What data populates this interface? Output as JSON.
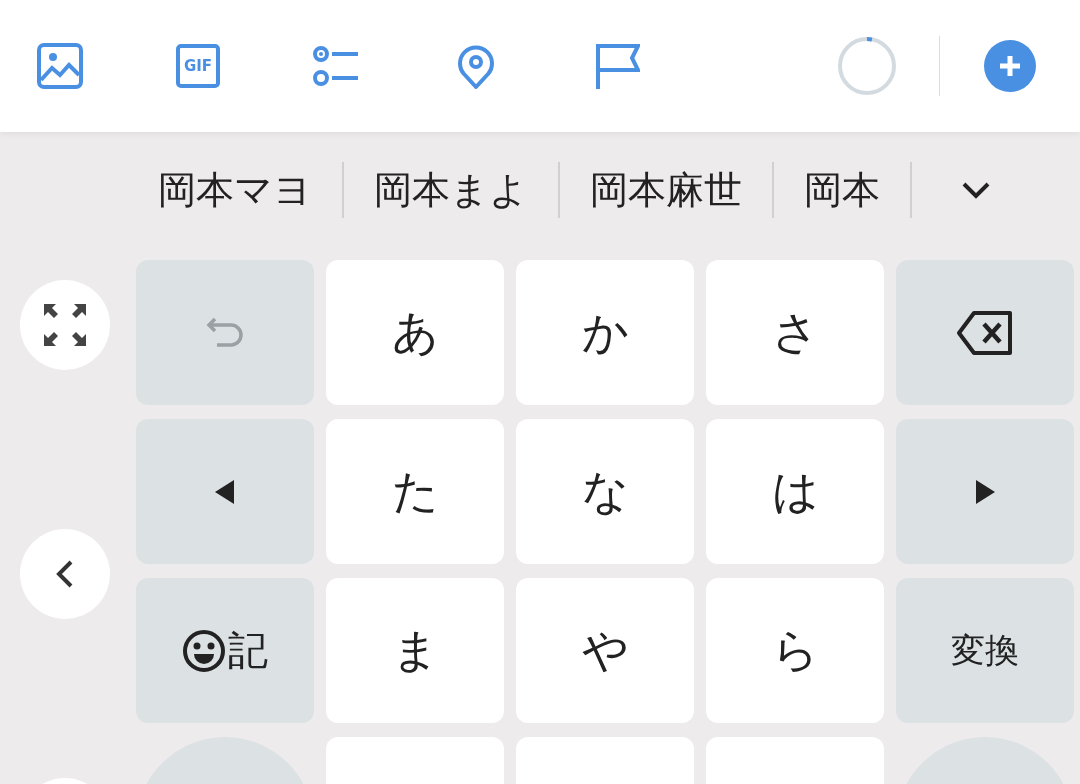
{
  "toolbar": {
    "tools": [
      {
        "kind": "image"
      },
      {
        "kind": "gif",
        "label": "GIF"
      },
      {
        "kind": "poll"
      },
      {
        "kind": "location"
      },
      {
        "kind": "flag"
      }
    ],
    "progress": {
      "level": 0.03
    }
  },
  "suggestions": {
    "items": [
      "岡本マヨ",
      "岡本まよ",
      "岡本麻世",
      "岡本"
    ]
  },
  "side_buttons": [
    {
      "kind": "fullscreen"
    },
    {
      "kind": "back"
    },
    {
      "kind": "blank"
    }
  ],
  "keys": [
    [
      {
        "kind": "undo",
        "disabled": true
      },
      {
        "kind": "char",
        "label": "あ"
      },
      {
        "kind": "char",
        "label": "か"
      },
      {
        "kind": "char",
        "label": "さ"
      },
      {
        "kind": "delete"
      }
    ],
    [
      {
        "kind": "left"
      },
      {
        "kind": "char",
        "label": "た"
      },
      {
        "kind": "char",
        "label": "な"
      },
      {
        "kind": "char",
        "label": "は"
      },
      {
        "kind": "right"
      }
    ],
    [
      {
        "kind": "symbol",
        "label": "記"
      },
      {
        "kind": "char",
        "label": "ま"
      },
      {
        "kind": "char",
        "label": "や"
      },
      {
        "kind": "char",
        "label": "ら"
      },
      {
        "kind": "text",
        "label": "変換"
      }
    ],
    [
      {
        "kind": "pill"
      },
      {
        "kind": "blank"
      },
      {
        "kind": "blank"
      },
      {
        "kind": "blank"
      },
      {
        "kind": "pill"
      }
    ]
  ]
}
